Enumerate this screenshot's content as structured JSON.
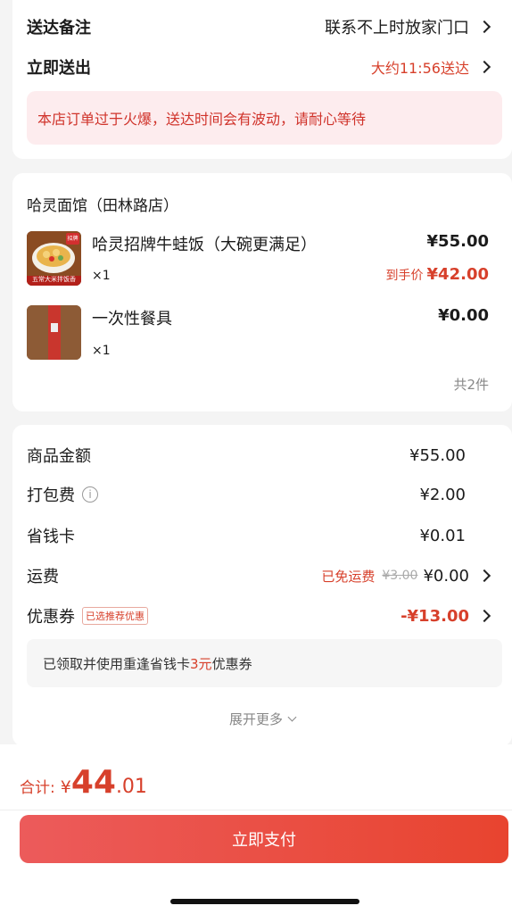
{
  "delivery": {
    "note_label": "送达备注",
    "note_value": "联系不上时放家门口",
    "time_label": "立即送出",
    "time_value": "大约11:56送达",
    "notice": "本店订单过于火爆，送达时间会有波动，请耐心等待"
  },
  "order": {
    "store_name": "哈灵面馆（田林路店）",
    "items": [
      {
        "name": "哈灵招牌牛蛙饭（大碗更满足）",
        "quantity": "×1",
        "price": "¥55.00",
        "final_price_label": "到手价",
        "final_price": "¥42.00",
        "image_badge": "五常大米拌饭香",
        "image_stamp": "招牌"
      },
      {
        "name": "一次性餐具",
        "quantity": "×1",
        "price": "¥0.00"
      }
    ],
    "total_count": "共2件"
  },
  "summary": {
    "goods_label": "商品金额",
    "goods_value": "¥55.00",
    "packing_label": "打包费",
    "packing_value": "¥2.00",
    "savecard_label": "省钱卡",
    "savecard_value": "¥0.01",
    "shipping_label": "运费",
    "shipping_free": "已免运费",
    "shipping_original": "¥3.00",
    "shipping_value": "¥0.00",
    "coupon_label": "优惠券",
    "coupon_tag": "已选推荐优惠",
    "coupon_value": "-¥13.00",
    "coupon_note_prefix": "已领取并使用重逢省钱卡",
    "coupon_note_amount": "3元",
    "coupon_note_suffix": "优惠券",
    "expand_label": "展开更多"
  },
  "footer": {
    "total_label": "合计:",
    "currency": "¥",
    "total_integer": "44",
    "total_decimal": ".01",
    "pay_label": "立即支付"
  },
  "colors": {
    "accent": "#d7402b",
    "pay_button_start": "#ec5b5b",
    "pay_button_end": "#e8442f",
    "notice_bg": "#fdecee"
  }
}
